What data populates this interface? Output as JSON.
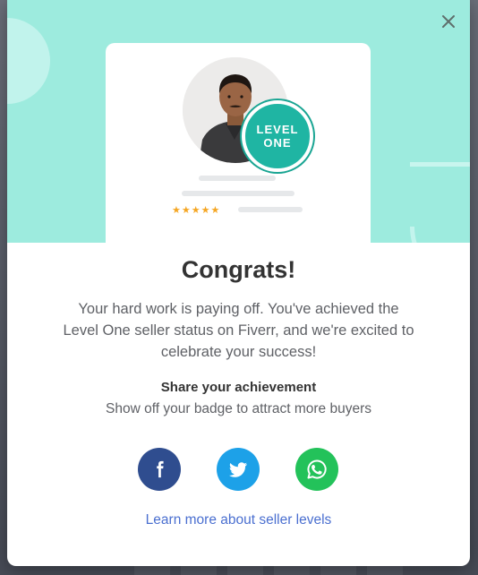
{
  "modal": {
    "badge": {
      "line1": "LEVEL",
      "line2": "ONE"
    },
    "rating_stars": "★★★★★",
    "title": "Congrats!",
    "message": "Your hard work is paying off. You've achieved the Level One seller status on Fiverr, and we're excited to celebrate your success!",
    "share": {
      "heading": "Share your achievement",
      "subtext": "Show off your badge to attract more buyers",
      "buttons": [
        {
          "icon": "facebook-icon",
          "color": "#2f4d8f"
        },
        {
          "icon": "twitter-icon",
          "color": "#1da1e8"
        },
        {
          "icon": "whatsapp-icon",
          "color": "#23c25a"
        }
      ]
    },
    "link": "Learn more about seller levels",
    "colors": {
      "hero_bg": "#9debde",
      "badge": "#1fb5a3",
      "link": "#4a6fd0",
      "stars": "#f5a623"
    },
    "icons": {
      "close": "close-icon"
    }
  }
}
